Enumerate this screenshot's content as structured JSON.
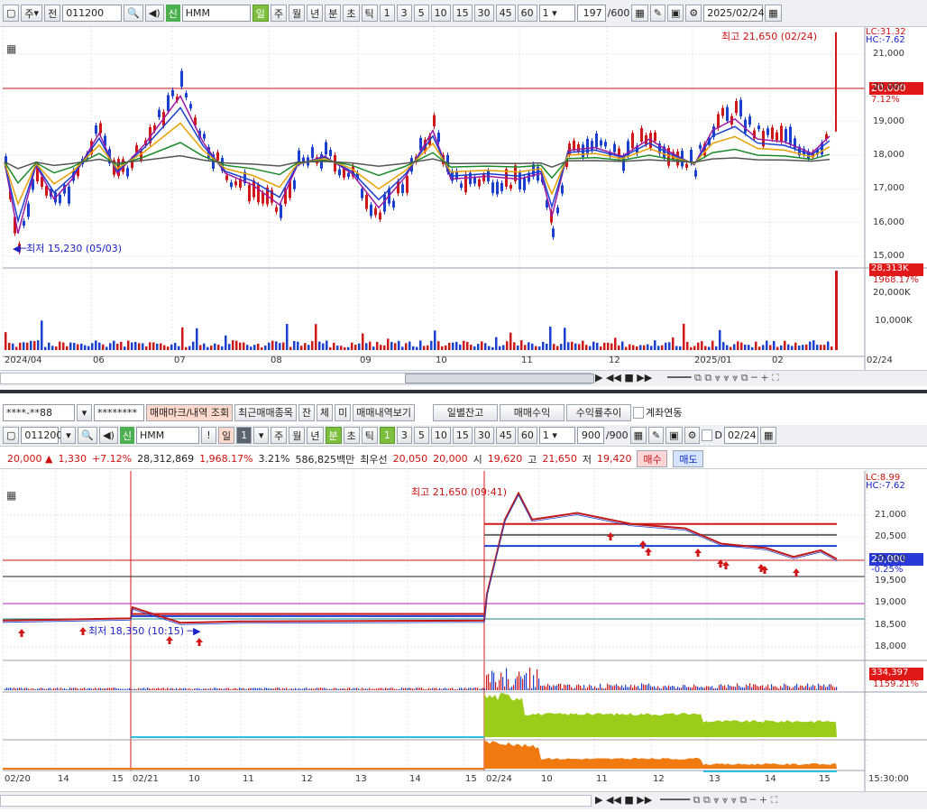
{
  "top": {
    "toolbar": {
      "period_btn": "주",
      "prev_label": "전",
      "code": "011200",
      "credit_tag": "신",
      "name": "HMM",
      "tabs": [
        "일",
        "주",
        "월",
        "년",
        "분",
        "초",
        "틱"
      ],
      "nums": [
        "1",
        "3",
        "5",
        "10",
        "15",
        "30",
        "45",
        "60"
      ],
      "count_sel": "1",
      "count": "197",
      "count_total": "/600",
      "date": "2025/02/24"
    },
    "legend": {
      "lc": "LC:31.32",
      "hc": "HC:-7.62"
    },
    "annot_high": "최고 21,650 (02/24)",
    "annot_low": "최저 15,230 (05/03)",
    "price_labels": [
      "21,000",
      "20,000",
      "19,000",
      "18,000",
      "17,000",
      "16,000",
      "15,000"
    ],
    "cur_price": "20,000",
    "cur_pct": "7.12%",
    "vol_labels": [
      "20,000K",
      "10,000K"
    ],
    "cur_vol": "28,313K",
    "vol_pct": "1968.17%",
    "x_labels": [
      "2024/04",
      "06",
      "07",
      "08",
      "09",
      "10",
      "11",
      "12",
      "2025/01",
      "02",
      "02/24"
    ]
  },
  "mid": {
    "account": "****-**88",
    "password": "********",
    "buttons": [
      "매매마크/내역 조회",
      "최근매매종목",
      "잔",
      "체",
      "미",
      "매매내역보기",
      "일별잔고",
      "매매수익",
      "수익률추이"
    ],
    "link_label": "계좌연동"
  },
  "bottom": {
    "toolbar": {
      "code": "011200",
      "credit_tag": "신",
      "name": "HMM",
      "bang": "!",
      "tab_day": "일",
      "day_num": "1",
      "tabs": [
        "주",
        "월",
        "년",
        "분",
        "초",
        "틱"
      ],
      "nums": [
        "1",
        "3",
        "5",
        "10",
        "15",
        "30",
        "45",
        "60"
      ],
      "count_sel": "1",
      "count": "900",
      "count_total": "/900",
      "d_label": "D",
      "date": "02/24"
    },
    "quote": {
      "price": "20,000 ▲",
      "change": "1,330",
      "rate": "+7.12%",
      "volume": "28,312,869",
      "vol_rate": "1,968.17%",
      "turnover": "3.21%",
      "amount": "586,825백만",
      "best_label": "최우선",
      "ask": "20,050",
      "bid": "20,000",
      "open_label": "시",
      "open": "19,620",
      "high_label": "고",
      "high": "21,650",
      "low_label": "저",
      "low": "19,420",
      "buy": "매수",
      "sell": "매도"
    },
    "legend": {
      "lc": "LC:8.99",
      "hc": "HC:-7.62"
    },
    "annot_high": "최고 21,650 (09:41)",
    "annot_low": "최저 18,350 (10:15)",
    "price_labels": [
      "21,000",
      "20,500",
      "20,000",
      "19,500",
      "19,000",
      "18,500",
      "18,000"
    ],
    "cur_price": "20,000",
    "cur_pct": "-0.25%",
    "cur_vol": "334,397",
    "vol_pct": "1159.21%",
    "x_labels": [
      "02/20",
      "14",
      "15",
      "02/21",
      "10",
      "11",
      "12",
      "13",
      "14",
      "15",
      "02/24",
      "10",
      "11",
      "12",
      "13",
      "14",
      "15",
      "15:30:00"
    ]
  }
}
